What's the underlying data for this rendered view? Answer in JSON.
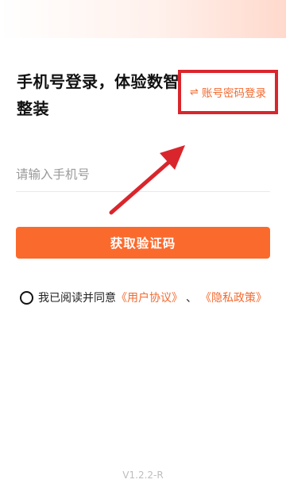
{
  "heading": "手机号登录，体验数智整装",
  "switch_login": {
    "icon": "swap-arrows-icon",
    "glyph": "⇌",
    "label": "账号密码登录"
  },
  "phone_input": {
    "placeholder": "请输入手机号",
    "value": ""
  },
  "get_code_button": "获取验证码",
  "agreement": {
    "checked": false,
    "prefix": "我已阅读并同意",
    "user_agreement": "《用户协议》",
    "separator": "、",
    "privacy_policy": "《隐私政策》"
  },
  "version": "V1.2.2-R",
  "colors": {
    "accent": "#fb6a2d",
    "link": "#f36a2f",
    "highlight_box": "#d9262c",
    "annotation_arrow": "#d9262c"
  }
}
